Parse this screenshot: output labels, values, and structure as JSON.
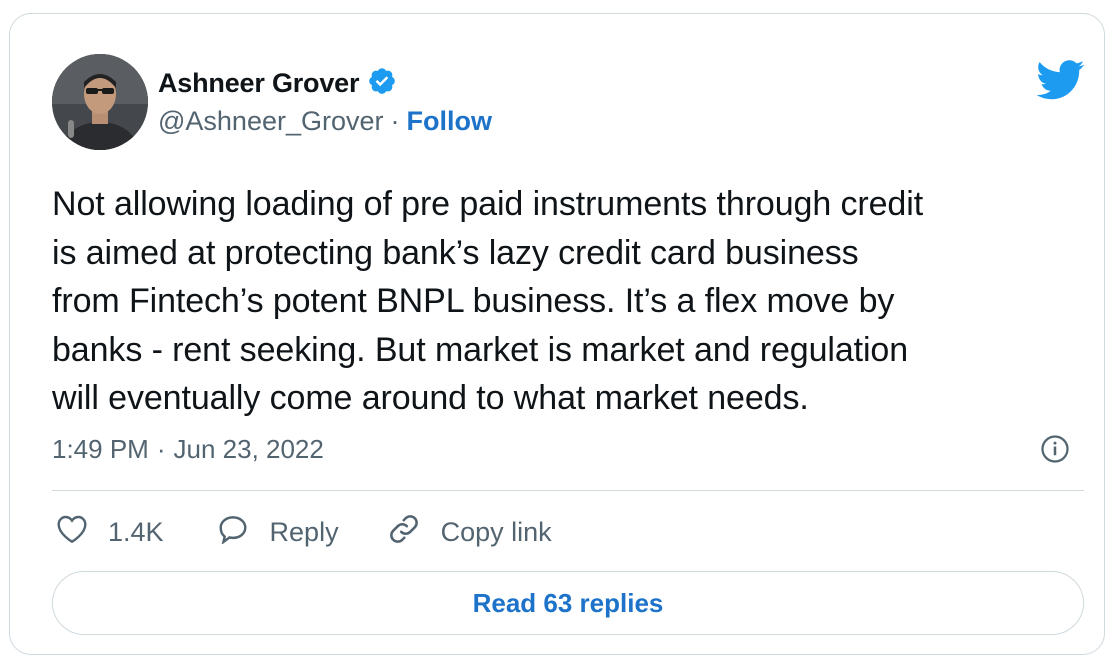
{
  "author": {
    "name": "Ashneer Grover",
    "handle": "@Ashneer_Grover",
    "separator": "·",
    "follow_label": "Follow",
    "verified": true,
    "avatar_icon": "profile-photo"
  },
  "tweet": {
    "text": "Not allowing loading of pre paid instruments through credit\nis aimed at protecting bank’s lazy credit card business\nfrom Fintech’s potent BNPL business. It’s a flex move by\nbanks - rent seeking. But market is market and regulation\nwill eventually come around to what market needs.",
    "time": "1:49 PM",
    "separator": "·",
    "date": "Jun 23, 2022"
  },
  "actions": {
    "like_count": "1.4K",
    "reply_label": "Reply",
    "copy_link_label": "Copy link"
  },
  "read_replies_label": "Read 63 replies",
  "colors": {
    "accent": "#1d72c9",
    "twitter_blue": "#1d9bf0",
    "muted_text": "#536471",
    "border": "#cfd9de"
  },
  "icons": {
    "brand": "twitter-bird-icon",
    "verified": "verified-badge-icon",
    "info": "info-icon",
    "like": "heart-icon",
    "reply": "speech-bubble-icon",
    "copy_link": "link-icon"
  }
}
